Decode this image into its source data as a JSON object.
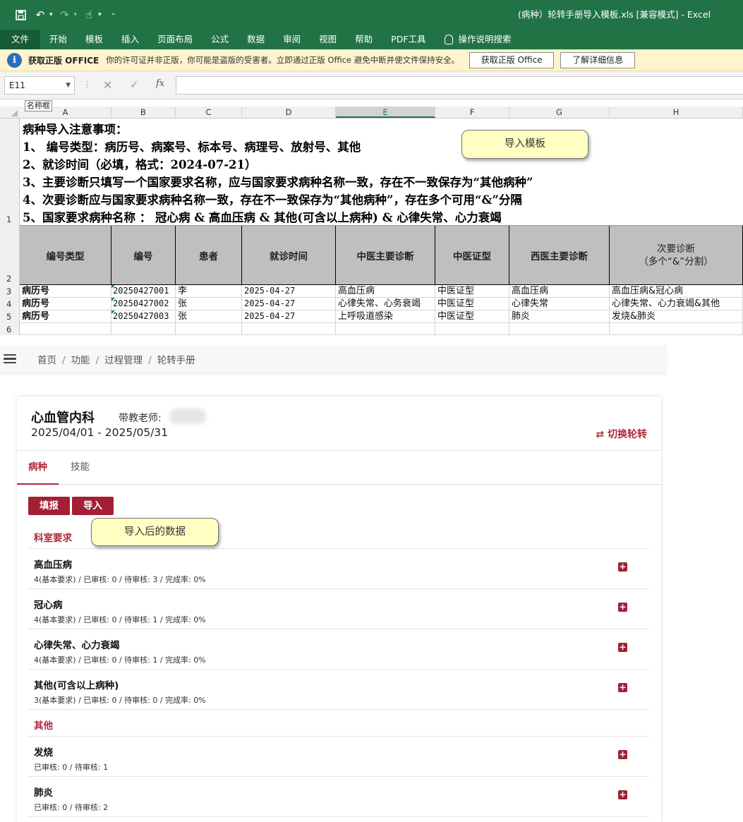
{
  "excel": {
    "window_title": "(病种）轮转手册导入模板.xls  [兼容模式]  -  Excel",
    "menu": [
      "文件",
      "开始",
      "模板",
      "插入",
      "页面布局",
      "公式",
      "数据",
      "审阅",
      "视图",
      "帮助",
      "PDF工具"
    ],
    "tell_me": "操作说明搜索",
    "message_bar": {
      "title": "获取正版 OFFICE",
      "text": "你的许可证并非正版，你可能是盗版的受害者。立即通过正版 Office 避免中断并使文件保持安全。",
      "btn_get": "获取正版 Office",
      "btn_learn": "了解详细信息"
    },
    "name_box": "E11",
    "name_box_tooltip": "名称框",
    "columns": [
      "A",
      "B",
      "C",
      "D",
      "E",
      "F",
      "G",
      "H"
    ],
    "selected_column": "E",
    "rows": [
      "1",
      "2",
      "3",
      "4",
      "5",
      "6"
    ],
    "notes": [
      "病种导入注意事项：",
      "1、  编号类型：病历号、病案号、标本号、病理号、放射号、其他",
      "2、就诊时间（必填，格式：2024-07-21）",
      "3、主要诊断只填写一个国家要求名称，应与国家要求病种名称一致，存在不一致保存为“其他病种”",
      "4、次要诊断应与国家要求病种名称一致，存在不一致保存为“其他病种”，存在多个可用“&”分隔",
      "5、国家要求病种名称 ：  冠心病 & 高血压病 & 其他(可含以上病种) & 心律失常、心力衰竭"
    ],
    "header_cells": [
      "编号类型",
      "编号",
      "患者",
      "就诊时间",
      "中医主要诊断",
      "中医证型",
      "西医主要诊断"
    ],
    "header_secondary": [
      "次要诊断",
      "（多个“&”分割）"
    ],
    "data_rows": [
      [
        "病历号",
        "20250427001",
        "李",
        "2025-04-27",
        "高血压病",
        "中医证型",
        "高血压病",
        "高血压病&冠心病"
      ],
      [
        "病历号",
        "20250427002",
        "张",
        "2025-04-27",
        "心律失常、心务衰竭",
        "中医证型",
        "心律失常",
        "心律失常、心力衰竭&其他"
      ],
      [
        "病历号",
        "20250427003",
        "张",
        "2025-04-27",
        "上呼吸道感染",
        "中医证型",
        "肺炎",
        "发烧&肺炎"
      ]
    ],
    "callout": "导入模板"
  },
  "app": {
    "breadcrumb": [
      "首页",
      "功能",
      "过程管理",
      "轮转手册"
    ],
    "department": "心血管内科",
    "teacher_label": "带教老师:",
    "period": "2025/04/01 - 2025/05/31",
    "switch_label": "⇄ 切换轮转",
    "tabs": [
      "病种",
      "技能"
    ],
    "btn_fill": "填报",
    "btn_import": "导入",
    "callout": "导入后的数据",
    "section_required": "科室要求",
    "section_other": "其他",
    "required_items": [
      {
        "name": "高血压病",
        "stat": "4(基本要求) / 已审核: 0 / 待审核: 3 / 完成率: 0%"
      },
      {
        "name": "冠心病",
        "stat": "4(基本要求) / 已审核: 0 / 待审核: 1 / 完成率: 0%"
      },
      {
        "name": "心律失常、心力衰竭",
        "stat": "4(基本要求) / 已审核: 0 / 待审核: 1 / 完成率: 0%"
      },
      {
        "name": "其他(可含以上病种)",
        "stat": "3(基本要求) / 已审核: 0 / 待审核: 0 / 完成率: 0%"
      }
    ],
    "other_items": [
      {
        "name": "发烧",
        "stat": "已审核: 0 / 待审核: 1"
      },
      {
        "name": "肺炎",
        "stat": "已审核: 0 / 待审核: 2"
      }
    ],
    "colors": {
      "accent": "#a31f34",
      "excel_green": "#217346"
    }
  }
}
